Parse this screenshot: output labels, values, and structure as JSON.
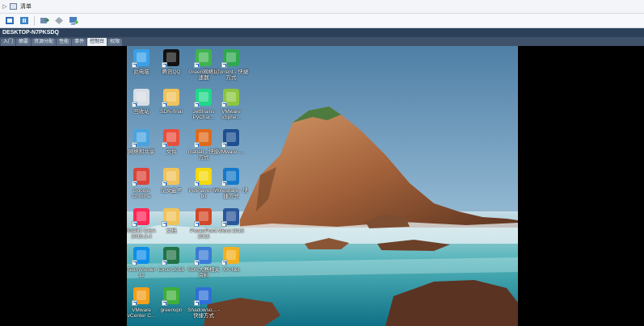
{
  "menubar": {
    "arrow": "▷",
    "title": "清单"
  },
  "header": {
    "host": "DESKTOP-N7PKSDQ"
  },
  "tabs": [
    {
      "label": "入门",
      "active": false
    },
    {
      "label": "摘要",
      "active": false
    },
    {
      "label": "资源分配",
      "active": false
    },
    {
      "label": "性能",
      "active": false
    },
    {
      "label": "事件",
      "active": false
    },
    {
      "label": "控制台",
      "active": true
    },
    {
      "label": "权限",
      "active": false
    }
  ],
  "desktop_icons": [
    {
      "label": "此电脑",
      "icon": "computer-icon",
      "color": "#3aa0e8"
    },
    {
      "label": "腾讯QQ",
      "icon": "qq-icon",
      "color": "#111111"
    },
    {
      "label": "Green网络加速器",
      "icon": "green-accelerator-icon",
      "color": "#3fb34f"
    },
    {
      "label": "uTorrent - 快捷方式",
      "icon": "utorrent-icon",
      "color": "#2fa84f"
    },
    {
      "label": "回收站",
      "icon": "recycle-bin-icon",
      "color": "#d7dde5"
    },
    {
      "label": "SDN-final",
      "icon": "folder-icon",
      "color": "#f0c35a"
    },
    {
      "label": "JetBrains PyChar...",
      "icon": "pycharm-icon",
      "color": "#21d789"
    },
    {
      "label": "VMware vSphe...",
      "icon": "vmware-vsphere-icon",
      "color": "#8cc63f"
    },
    {
      "label": "网络和共享",
      "icon": "network-icon",
      "color": "#4aa3df"
    },
    {
      "label": "文件",
      "icon": "file-icon",
      "color": "#e84f3d"
    },
    {
      "label": "matlab - 快捷方式",
      "icon": "matlab-icon",
      "color": "#e06a1b"
    },
    {
      "label": "VMware -...",
      "icon": "vmware-icon",
      "color": "#1d4f91"
    },
    {
      "label": "Google Chrome",
      "icon": "chrome-icon",
      "color": "#db4437"
    },
    {
      "label": "论文盒子",
      "icon": "folder-icon",
      "color": "#f0c35a"
    },
    {
      "label": "PotPlayer 64 bit",
      "icon": "potplayer-icon",
      "color": "#f5d90a"
    },
    {
      "label": "Wireshark - 快捷方式",
      "icon": "wireshark-icon",
      "color": "#1679c9"
    },
    {
      "label": "IntelliJ IDEA 2019.3.4",
      "icon": "intellij-icon",
      "color": "#fe2857"
    },
    {
      "label": "文档",
      "icon": "folder-icon",
      "color": "#f0c35a"
    },
    {
      "label": "PowerPoint 2016",
      "icon": "powerpoint-icon",
      "color": "#d24726"
    },
    {
      "label": "Word 2016",
      "icon": "word-icon",
      "color": "#2b579a"
    },
    {
      "label": "TeamViewer 12",
      "icon": "teamviewer-icon",
      "color": "#0e8ee9"
    },
    {
      "label": "Excel 2016",
      "icon": "excel-icon",
      "color": "#217346"
    },
    {
      "label": "SDN大赛相关资料",
      "icon": "archive-icon",
      "color": "#3a7bd5"
    },
    {
      "label": "XX-Net",
      "icon": "xxnet-icon",
      "color": "#f2b01e"
    },
    {
      "label": "VMware vCenter C...",
      "icon": "vcenter-icon",
      "color": "#f29f1a"
    },
    {
      "label": "greenvpn",
      "icon": "greenvpn-icon",
      "color": "#3fae3a"
    },
    {
      "label": "Shadowso... - 快捷方式",
      "icon": "shadowsocks-icon",
      "color": "#2f6fd6"
    }
  ]
}
